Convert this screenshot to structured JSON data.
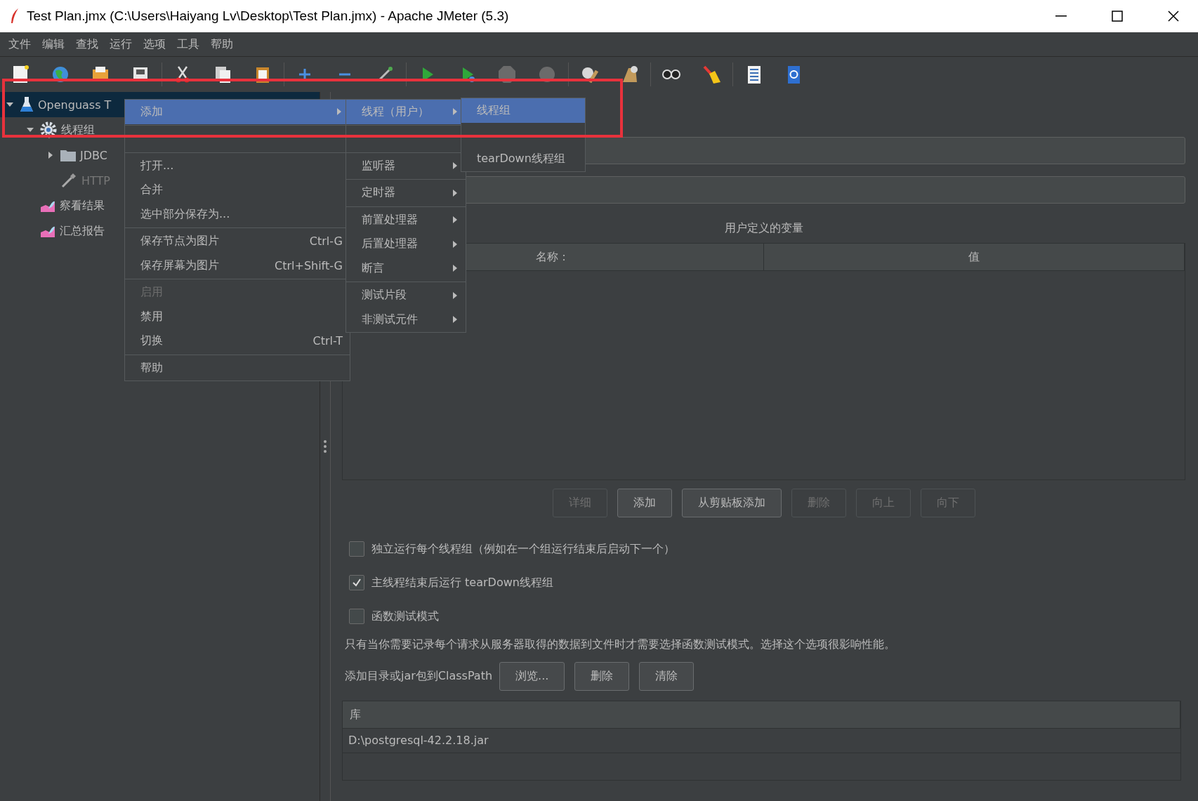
{
  "window": {
    "title": "Test Plan.jmx (C:\\Users\\Haiyang Lv\\Desktop\\Test Plan.jmx) - Apache JMeter (5.3)"
  },
  "menu_bar": [
    "文件",
    "编辑",
    "查找",
    "运行",
    "选项",
    "工具",
    "帮助"
  ],
  "tree": [
    {
      "label": "Openguass T",
      "kind": "plan",
      "selected": true,
      "disabled": false,
      "expanded": true,
      "children": [
        {
          "label": "线程组",
          "kind": "threads",
          "selected": false,
          "disabled": false,
          "expanded": true,
          "children": [
            {
              "label": "JDBC",
              "kind": "folder",
              "selected": false,
              "disabled": false,
              "expanded": false
            },
            {
              "label": "HTTP",
              "kind": "sampler",
              "selected": false,
              "disabled": true
            }
          ]
        },
        {
          "label": "察看结果",
          "kind": "listener",
          "selected": false,
          "disabled": false
        },
        {
          "label": "汇总报告",
          "kind": "listener",
          "selected": false,
          "disabled": false
        }
      ]
    }
  ],
  "context_menu": [
    [
      {
        "label": "添加",
        "selected": true,
        "disabled": false,
        "submenu": true
      }
    ],
    [
      {
        "label": "打开...",
        "selected": false,
        "disabled": false,
        "submenu": false
      },
      {
        "label": "合并",
        "selected": false,
        "disabled": false,
        "submenu": false
      },
      {
        "label": "选中部分保存为...",
        "selected": false,
        "disabled": false,
        "submenu": false
      }
    ],
    [
      {
        "label": "保存节点为图片",
        "shortcut": "Ctrl-G",
        "selected": false,
        "disabled": false,
        "submenu": false
      },
      {
        "label": "保存屏幕为图片",
        "shortcut": "Ctrl+Shift-G",
        "selected": false,
        "disabled": false,
        "submenu": false
      }
    ],
    [
      {
        "label": "启用",
        "selected": false,
        "disabled": true,
        "submenu": false
      },
      {
        "label": "禁用",
        "selected": false,
        "disabled": false,
        "submenu": false
      },
      {
        "label": "切换",
        "shortcut": "Ctrl-T",
        "selected": false,
        "disabled": false,
        "submenu": false
      }
    ],
    [
      {
        "label": "帮助",
        "selected": false,
        "disabled": false,
        "submenu": false
      }
    ]
  ],
  "add_submenu": [
    [
      {
        "label": "线程（用户）",
        "selected": true,
        "disabled": false,
        "submenu": true
      }
    ],
    [
      {
        "label": "监听器",
        "selected": false,
        "disabled": false,
        "submenu": true
      }
    ],
    [
      {
        "label": "定时器",
        "selected": false,
        "disabled": false,
        "submenu": true
      }
    ],
    [
      {
        "label": "前置处理器",
        "selected": false,
        "disabled": false,
        "submenu": true
      },
      {
        "label": "后置处理器",
        "selected": false,
        "disabled": false,
        "submenu": true
      },
      {
        "label": "断言",
        "selected": false,
        "disabled": false,
        "submenu": true
      }
    ],
    [
      {
        "label": "测试片段",
        "selected": false,
        "disabled": false,
        "submenu": true
      },
      {
        "label": "非测试元件",
        "selected": false,
        "disabled": false,
        "submenu": true
      }
    ]
  ],
  "threads_submenu": [
    [
      {
        "label": "线程组",
        "selected": true,
        "disabled": false,
        "submenu": false
      },
      {
        "label": "tearDown线程组",
        "selected": false,
        "disabled": false,
        "submenu": false
      }
    ]
  ],
  "variables_table": {
    "title": "用户定义的变量",
    "columns": [
      "名称：",
      "值"
    ]
  },
  "table_buttons": [
    {
      "label": "详细",
      "disabled": true
    },
    {
      "label": "添加",
      "disabled": false
    },
    {
      "label": "从剪贴板添加",
      "disabled": false
    },
    {
      "label": "删除",
      "disabled": true
    },
    {
      "label": "向上",
      "disabled": true
    },
    {
      "label": "向下",
      "disabled": true
    }
  ],
  "options": [
    {
      "label": "独立运行每个线程组（例如在一个组运行结束后启动下一个）",
      "checked": false
    },
    {
      "label": "主线程结束后运行 tearDown线程组",
      "checked": true
    },
    {
      "label": "函数测试模式",
      "checked": false
    }
  ],
  "note": "只有当你需要记录每个请求从服务器取得的数据到文件时才需要选择函数测试模式。选择这个选项很影响性能。",
  "classpath": {
    "label": "添加目录或jar包到ClassPath",
    "buttons": [
      "浏览...",
      "删除",
      "清除"
    ]
  },
  "library_table": {
    "columns": [
      "库"
    ],
    "rows": [
      [
        "D:\\postgresql-42.2.18.jar"
      ]
    ]
  }
}
